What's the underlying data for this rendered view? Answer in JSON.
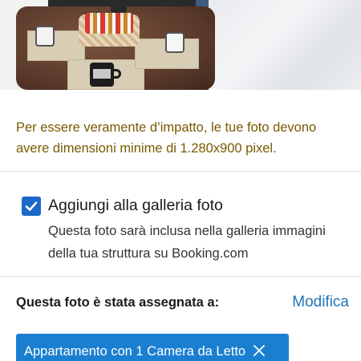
{
  "notice": {
    "text": "Per essere veramente d’impatto, le tue foto devono avere dimensioni minime di 1.280x900 pixel."
  },
  "gallery": {
    "checked": true,
    "label": "Aggiungi alla galleria foto",
    "description": "Questa foto sarà inclusa nella galleria immagini della tua struttura su Booking.com"
  },
  "assignment": {
    "label": "Questa foto è stata assegnata a:",
    "modify_label": "Modifica",
    "chip_label": "Appartamento con 1 Camera da Letto",
    "chip_icon": "close-icon"
  },
  "colors": {
    "accent": "#1b7fd1",
    "link": "#1f74b8",
    "notice_text": "#7a5900"
  }
}
